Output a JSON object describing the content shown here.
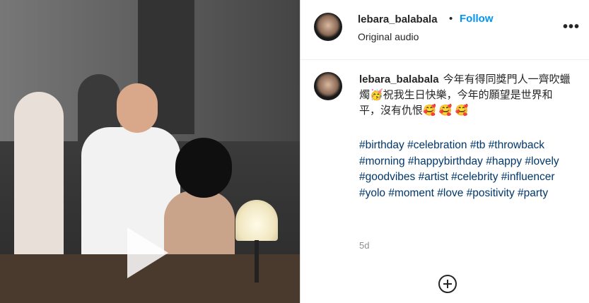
{
  "header": {
    "username": "lebara_balabala",
    "separator": "•",
    "follow_label": "Follow",
    "audio": "Original audio",
    "more_label": "•••"
  },
  "caption": {
    "username": "lebara_balabala",
    "text": "今年有得同獎門人一齊吹蠟燭🥳祝我生日快樂，今年的願望是世界和平，沒有仇恨🥰 🥰 🥰",
    "hashtags": "#birthday #celebration #tb #throwback #morning #happybirthday #happy #lovely #goodvibes #artist #celebrity #influencer #yolo #moment #love #positivity #party"
  },
  "meta": {
    "time": "5d"
  },
  "colors": {
    "link": "#0095f6",
    "hashtag": "#00376b",
    "muted": "#8e8e8e"
  },
  "icons": {
    "play": "play-icon",
    "add_comment": "plus-circle-icon",
    "more": "more-options-icon"
  }
}
